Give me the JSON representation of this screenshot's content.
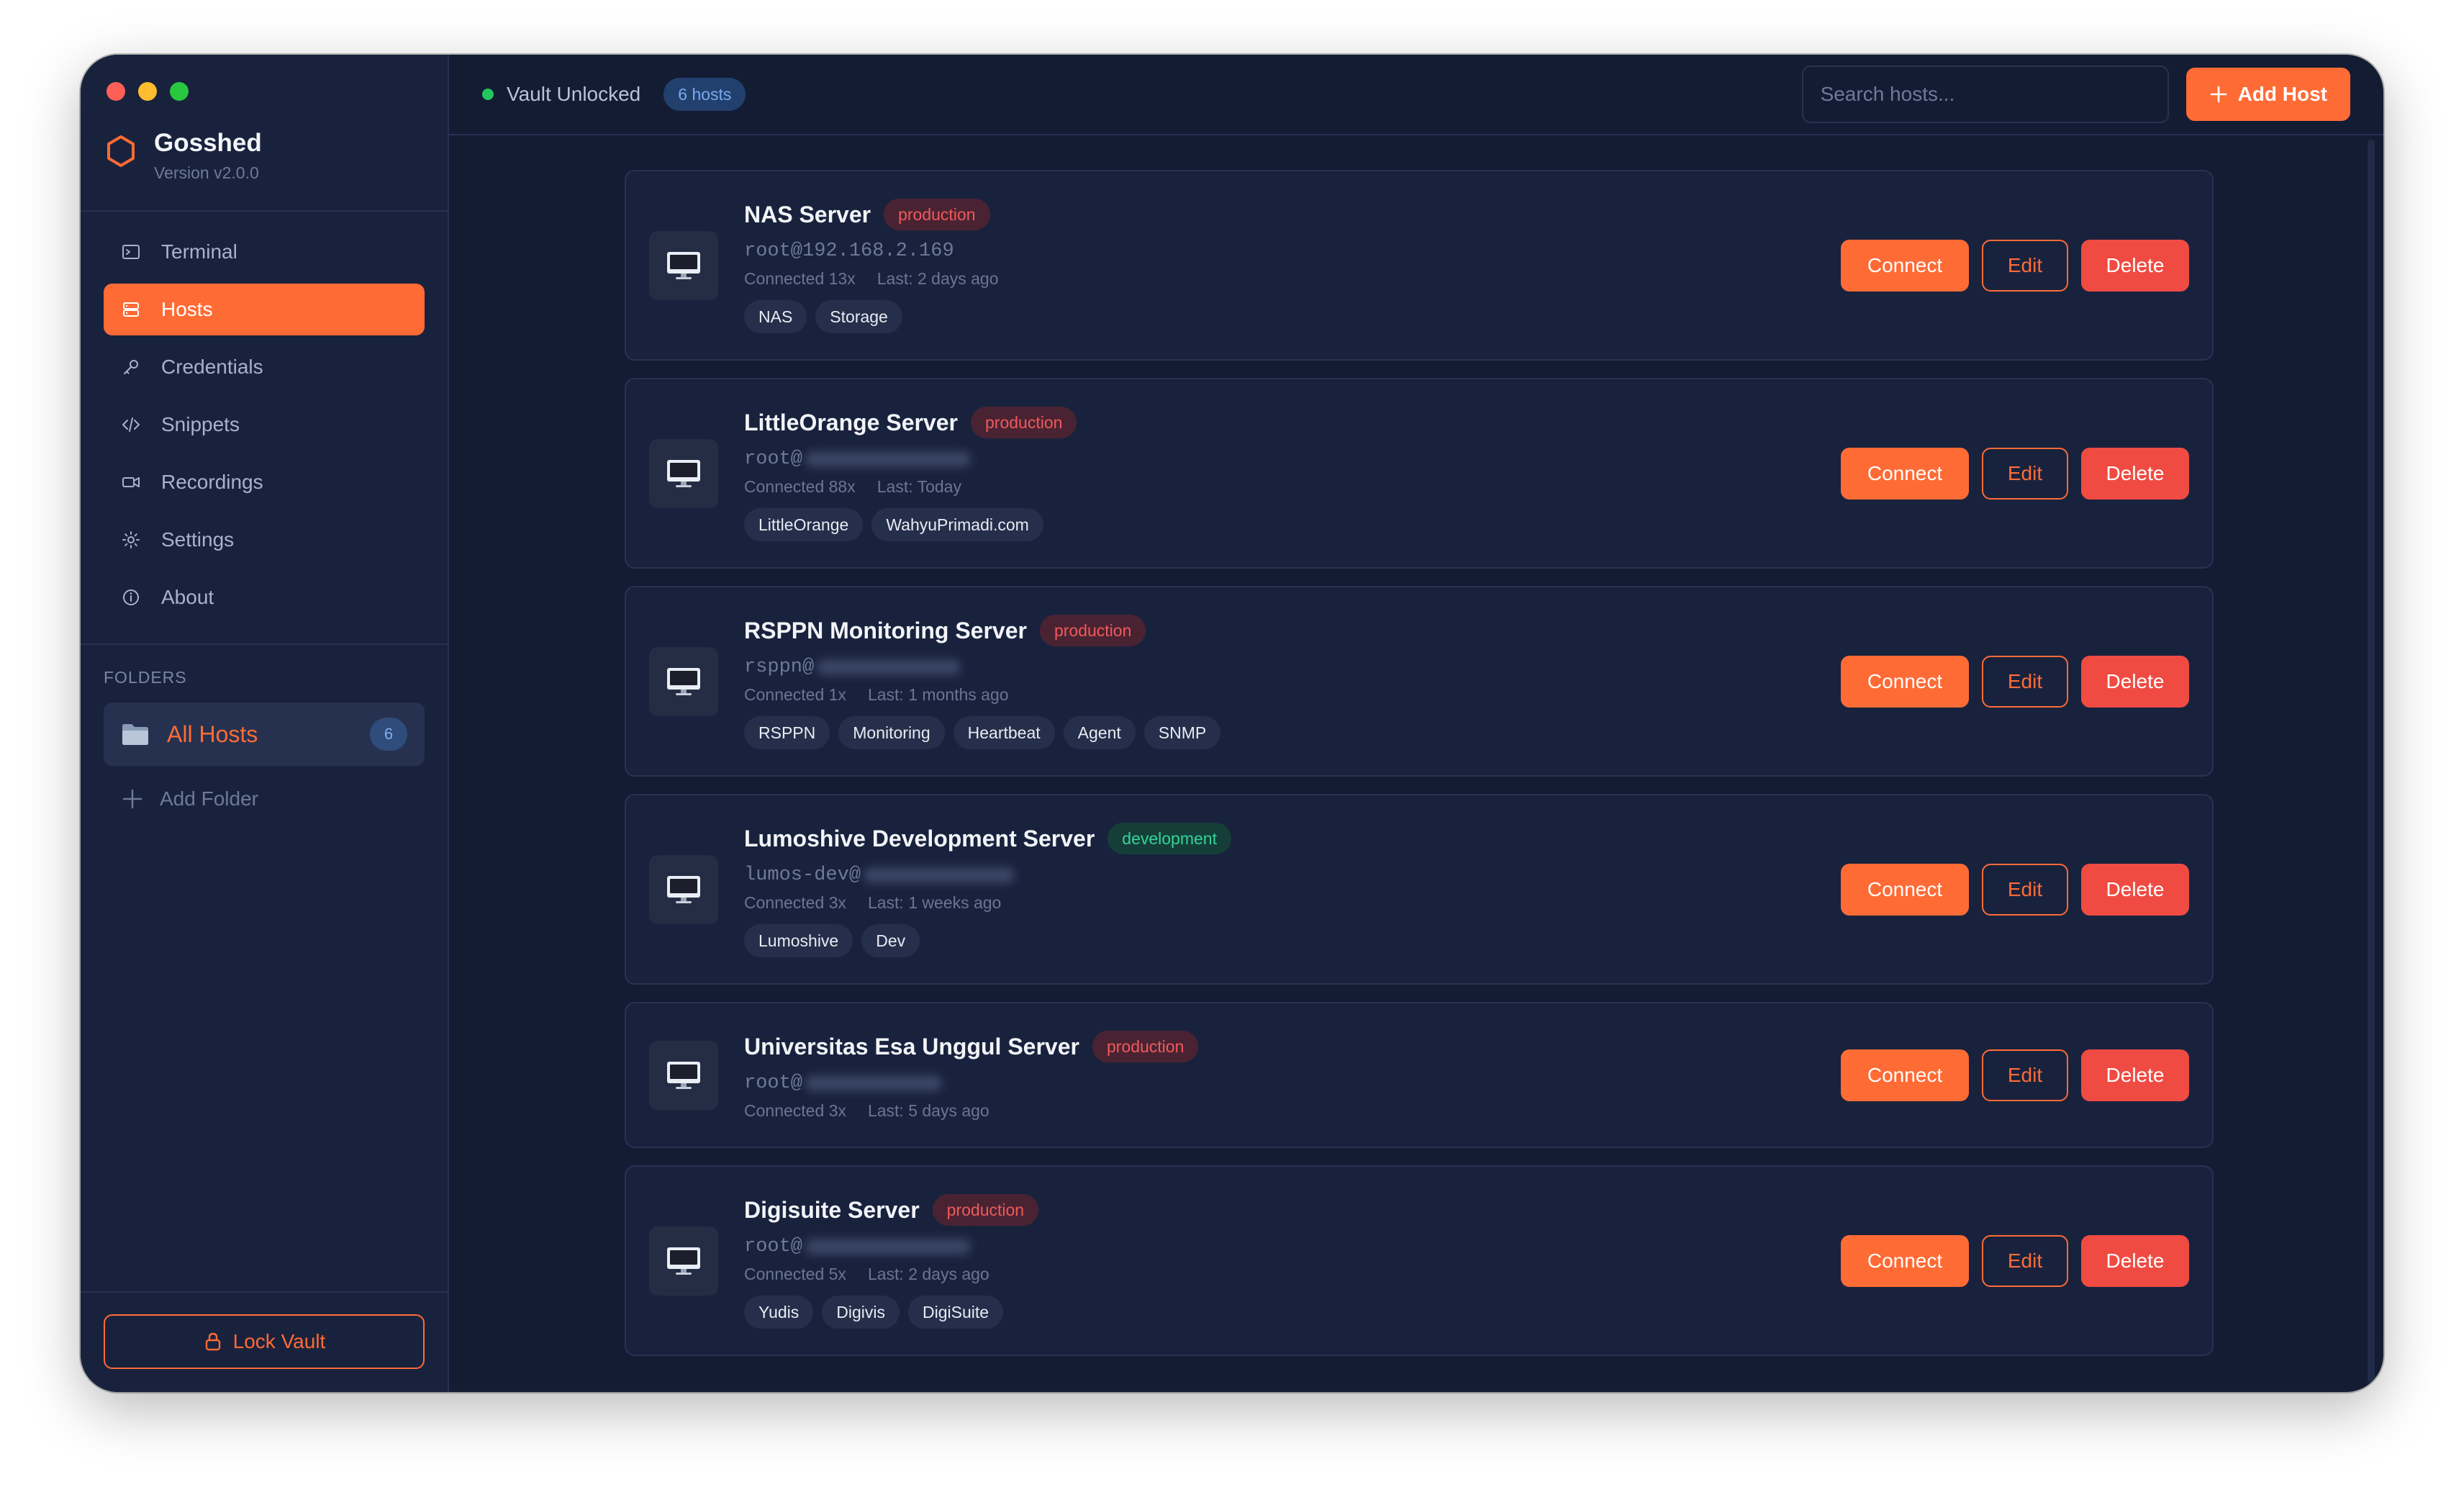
{
  "app": {
    "name": "Gosshed",
    "version": "Version v2.0.0",
    "accent_color": "#ff6b35"
  },
  "sidebar": {
    "nav": [
      {
        "label": "Terminal",
        "icon": "terminal-icon",
        "active": false
      },
      {
        "label": "Hosts",
        "icon": "server-icon",
        "active": true
      },
      {
        "label": "Credentials",
        "icon": "key-icon",
        "active": false
      },
      {
        "label": "Snippets",
        "icon": "code-icon",
        "active": false
      },
      {
        "label": "Recordings",
        "icon": "video-icon",
        "active": false
      },
      {
        "label": "Settings",
        "icon": "gear-icon",
        "active": false
      },
      {
        "label": "About",
        "icon": "info-icon",
        "active": false
      }
    ],
    "folders_label": "FOLDERS",
    "folders": [
      {
        "name": "All Hosts",
        "count": "6",
        "icon": "folder-icon"
      }
    ],
    "add_folder_label": "Add Folder",
    "lock_vault_label": "Lock Vault"
  },
  "topbar": {
    "status": "Vault Unlocked",
    "status_color": "#22c55e",
    "hosts_badge": "6 hosts",
    "search_placeholder": "Search hosts...",
    "add_host_label": "Add Host"
  },
  "actions": {
    "connect": "Connect",
    "edit": "Edit",
    "delete": "Delete"
  },
  "hosts": [
    {
      "name": "NAS Server",
      "environment": "production",
      "user": "root@",
      "address": "192.168.2.169",
      "address_hidden": false,
      "connected": "Connected 13x",
      "last": "Last: 2 days ago",
      "tags": [
        "NAS",
        "Storage"
      ]
    },
    {
      "name": "LittleOrange Server",
      "environment": "production",
      "user": "root@",
      "address": "",
      "address_hidden": true,
      "connected": "Connected 88x",
      "last": "Last: Today",
      "tags": [
        "LittleOrange",
        "WahyuPrimadi.com"
      ]
    },
    {
      "name": "RSPPN Monitoring Server",
      "environment": "production",
      "user": "rsppn@",
      "address": "",
      "address_hidden": true,
      "connected": "Connected 1x",
      "last": "Last: 1 months ago",
      "tags": [
        "RSPPN",
        "Monitoring",
        "Heartbeat",
        "Agent",
        "SNMP"
      ]
    },
    {
      "name": "Lumoshive Development Server",
      "environment": "development",
      "user": "lumos-dev@",
      "address": "",
      "address_hidden": true,
      "connected": "Connected 3x",
      "last": "Last: 1 weeks ago",
      "tags": [
        "Lumoshive",
        "Dev"
      ]
    },
    {
      "name": "Universitas Esa Unggul Server",
      "environment": "production",
      "user": "root@",
      "address": "",
      "address_hidden": true,
      "connected": "Connected 3x",
      "last": "Last: 5 days ago",
      "tags": []
    },
    {
      "name": "Digisuite Server",
      "environment": "production",
      "user": "root@",
      "address": "",
      "address_hidden": true,
      "connected": "Connected 5x",
      "last": "Last: 2 days ago",
      "tags": [
        "Yudis",
        "Digivis",
        "DigiSuite"
      ]
    }
  ]
}
